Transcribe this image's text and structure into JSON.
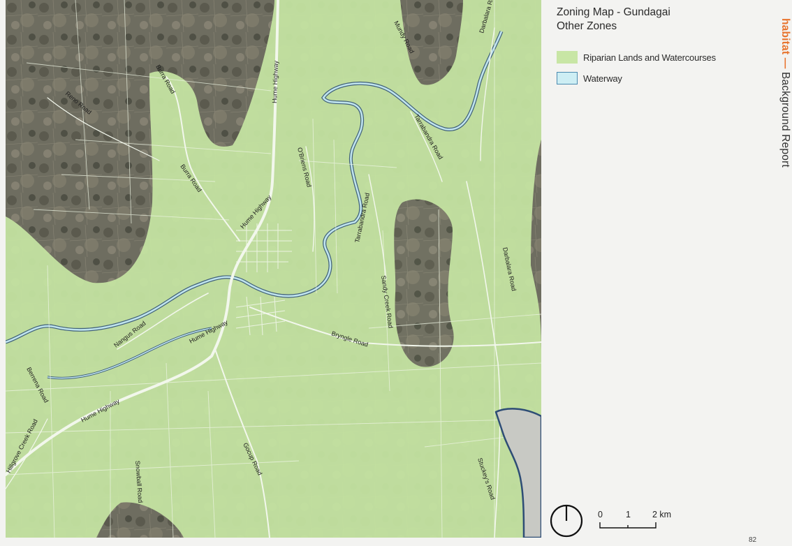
{
  "title": {
    "line1": "Zoning Map - Gundagai",
    "line2": "Other Zones"
  },
  "legend": [
    {
      "label": "Riparian Lands and Watercourses",
      "color": "#c8e6a5",
      "border": "#b8d895"
    },
    {
      "label": "Waterway",
      "color": "#cdeef4",
      "border": "#4a8ab0"
    }
  ],
  "brand": {
    "accent": "habitat —",
    "text": "Background Report",
    "accent_color": "#e8742e"
  },
  "page_number": "82",
  "scale": {
    "ticks": [
      "0",
      "1",
      "2 km"
    ]
  },
  "map": {
    "road_labels": [
      "Burra Road",
      "Reno Road",
      "Hume Highway",
      "Hume Highway",
      "Hume Highway",
      "Hume Highway",
      "O'Briens Road",
      "Tarrabandra Road",
      "Tarrabandra Road",
      "Darbalara Road",
      "Darbalara Road",
      "Sandy Creek Road",
      "Bryngle Road",
      "Nangus Road",
      "Berrena Road",
      "Hillgrove Creek Road",
      "Gocup Road",
      "Snowball Road",
      "Stuckey's Road",
      "Mundy Road",
      "Burra Road"
    ]
  }
}
